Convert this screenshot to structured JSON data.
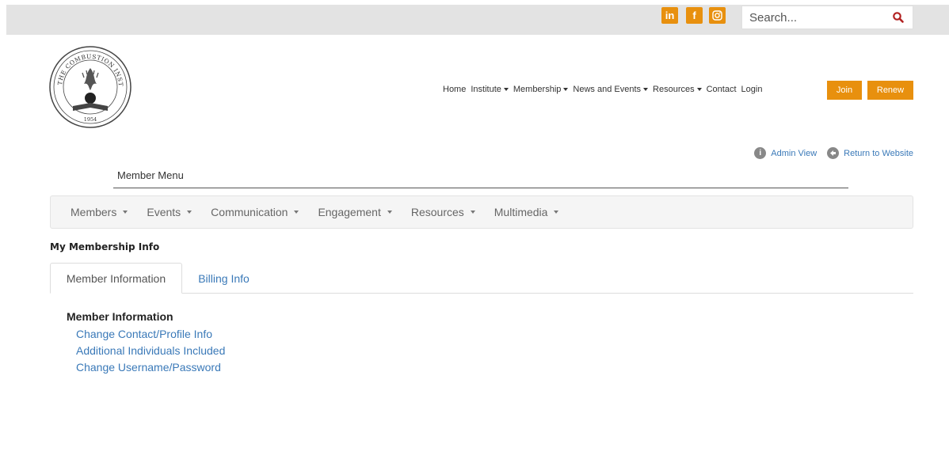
{
  "topbar": {
    "social": [
      {
        "name": "linkedin",
        "glyph": "in"
      },
      {
        "name": "facebook",
        "glyph": "f"
      },
      {
        "name": "instagram",
        "glyph": ""
      }
    ],
    "search": {
      "placeholder": "Search..."
    }
  },
  "logo": {
    "top_text": "THE COMBUSTION INSTITUTE",
    "year": "1954"
  },
  "nav": {
    "items": [
      {
        "label": "Home",
        "dropdown": false
      },
      {
        "label": "Institute",
        "dropdown": true
      },
      {
        "label": "Membership",
        "dropdown": true
      },
      {
        "label": "News and Events",
        "dropdown": true
      },
      {
        "label": "Resources",
        "dropdown": true
      },
      {
        "label": "Contact",
        "dropdown": false
      },
      {
        "label": "Login",
        "dropdown": false
      }
    ],
    "join_label": "Join",
    "renew_label": "Renew"
  },
  "admin": {
    "admin_view": "Admin View",
    "return_to_website": "Return to Website"
  },
  "member_menu": {
    "label": "Member Menu",
    "items": [
      "Members",
      "Events",
      "Communication",
      "Engagement",
      "Resources",
      "Multimedia"
    ]
  },
  "page": {
    "title": "My Membership Info",
    "tabs": [
      {
        "label": "Member Information",
        "active": true
      },
      {
        "label": "Billing Info",
        "active": false
      }
    ],
    "section_heading": "Member Information",
    "links": [
      "Change Contact/Profile Info",
      "Additional Individuals Included",
      "Change Username/Password"
    ]
  },
  "colors": {
    "accent_orange": "#e8900e",
    "link_blue": "#3a79b8",
    "search_icon_red": "#b22222"
  }
}
